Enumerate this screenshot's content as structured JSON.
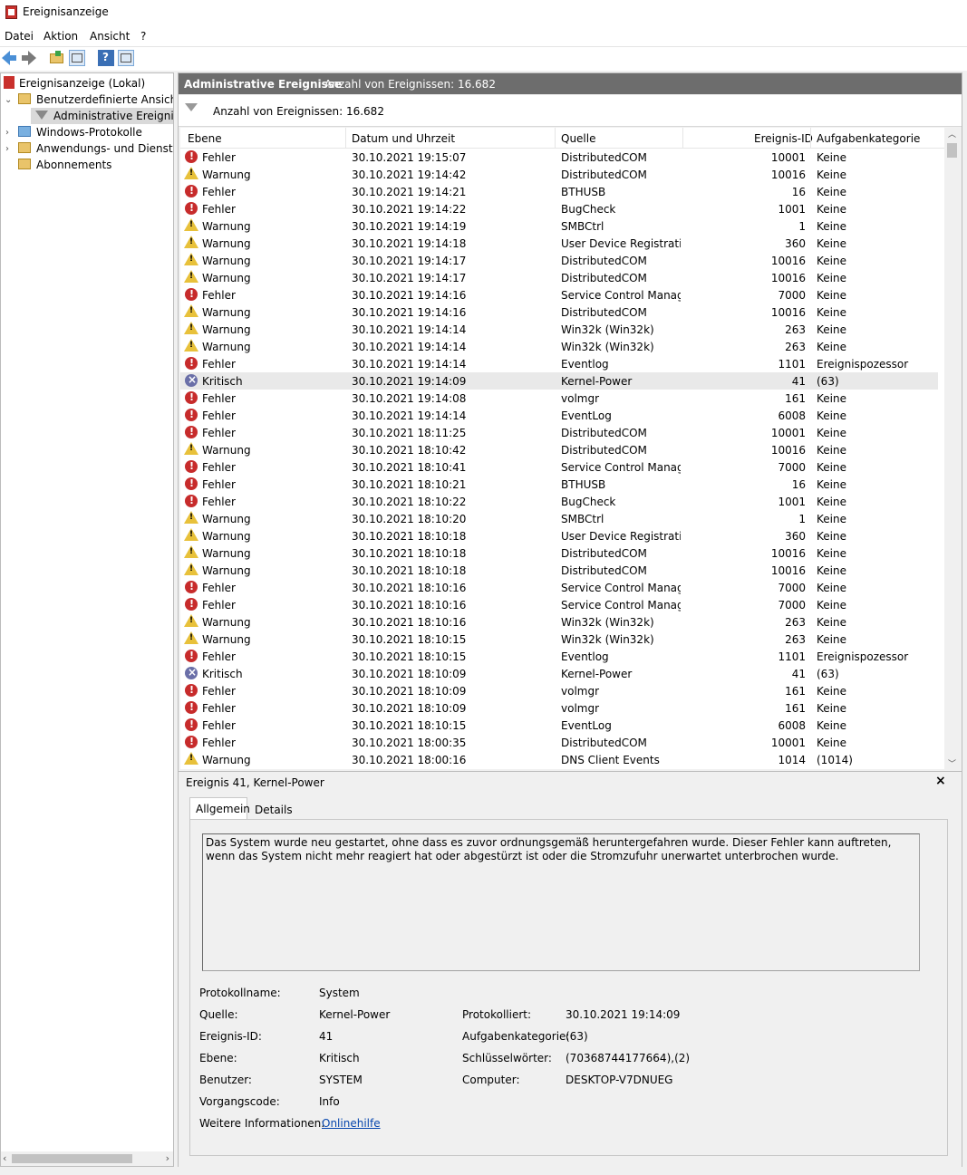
{
  "window": {
    "title": "Ereignisanzeige"
  },
  "menu": [
    "Datei",
    "Aktion",
    "Ansicht",
    "?"
  ],
  "toolbar": {
    "icons": [
      "back-arrow-icon",
      "forward-arrow-icon",
      "open-folder-icon",
      "show-hide-tree-icon",
      "help-icon",
      "show-hide-action-pane-icon"
    ]
  },
  "tree": {
    "root": "Ereignisanzeige (Lokal)",
    "custom_views": "Benutzerdefinierte Ansichten",
    "admin_events": "Administrative Ereignisse",
    "windows_logs": "Windows-Protokolle",
    "app_logs": "Anwendungs- und Dienstpro",
    "subscriptions": "Abonnements"
  },
  "main": {
    "header_title": "Administrative Ereignisse",
    "header_count": "Anzahl von Ereignissen: 16.682",
    "filter_text": "Anzahl von Ereignissen: 16.682",
    "columns": [
      "Ebene",
      "Datum und Uhrzeit",
      "Quelle",
      "Ereignis-ID",
      "Aufgabenkategorie"
    ],
    "selected_index": 13,
    "rows": [
      {
        "level": "Fehler",
        "icon": "error-icon",
        "date": "30.10.2021 19:15:07",
        "source": "DistributedCOM",
        "id": "10001",
        "cat": "Keine"
      },
      {
        "level": "Warnung",
        "icon": "warning-icon",
        "date": "30.10.2021 19:14:42",
        "source": "DistributedCOM",
        "id": "10016",
        "cat": "Keine"
      },
      {
        "level": "Fehler",
        "icon": "error-icon",
        "date": "30.10.2021 19:14:21",
        "source": "BTHUSB",
        "id": "16",
        "cat": "Keine"
      },
      {
        "level": "Fehler",
        "icon": "error-icon",
        "date": "30.10.2021 19:14:22",
        "source": "BugCheck",
        "id": "1001",
        "cat": "Keine"
      },
      {
        "level": "Warnung",
        "icon": "warning-icon",
        "date": "30.10.2021 19:14:19",
        "source": "SMBCtrl",
        "id": "1",
        "cat": "Keine"
      },
      {
        "level": "Warnung",
        "icon": "warning-icon",
        "date": "30.10.2021 19:14:18",
        "source": "User Device Registration",
        "id": "360",
        "cat": "Keine"
      },
      {
        "level": "Warnung",
        "icon": "warning-icon",
        "date": "30.10.2021 19:14:17",
        "source": "DistributedCOM",
        "id": "10016",
        "cat": "Keine"
      },
      {
        "level": "Warnung",
        "icon": "warning-icon",
        "date": "30.10.2021 19:14:17",
        "source": "DistributedCOM",
        "id": "10016",
        "cat": "Keine"
      },
      {
        "level": "Fehler",
        "icon": "error-icon",
        "date": "30.10.2021 19:14:16",
        "source": "Service Control Manag...",
        "id": "7000",
        "cat": "Keine"
      },
      {
        "level": "Warnung",
        "icon": "warning-icon",
        "date": "30.10.2021 19:14:16",
        "source": "DistributedCOM",
        "id": "10016",
        "cat": "Keine"
      },
      {
        "level": "Warnung",
        "icon": "warning-icon",
        "date": "30.10.2021 19:14:14",
        "source": "Win32k (Win32k)",
        "id": "263",
        "cat": "Keine"
      },
      {
        "level": "Warnung",
        "icon": "warning-icon",
        "date": "30.10.2021 19:14:14",
        "source": "Win32k (Win32k)",
        "id": "263",
        "cat": "Keine"
      },
      {
        "level": "Fehler",
        "icon": "error-icon",
        "date": "30.10.2021 19:14:14",
        "source": "Eventlog",
        "id": "1101",
        "cat": "Ereignispozessor"
      },
      {
        "level": "Kritisch",
        "icon": "critical-icon",
        "date": "30.10.2021 19:14:09",
        "source": "Kernel-Power",
        "id": "41",
        "cat": "(63)"
      },
      {
        "level": "Fehler",
        "icon": "error-icon",
        "date": "30.10.2021 19:14:08",
        "source": "volmgr",
        "id": "161",
        "cat": "Keine"
      },
      {
        "level": "Fehler",
        "icon": "error-icon",
        "date": "30.10.2021 19:14:14",
        "source": "EventLog",
        "id": "6008",
        "cat": "Keine"
      },
      {
        "level": "Fehler",
        "icon": "error-icon",
        "date": "30.10.2021 18:11:25",
        "source": "DistributedCOM",
        "id": "10001",
        "cat": "Keine"
      },
      {
        "level": "Warnung",
        "icon": "warning-icon",
        "date": "30.10.2021 18:10:42",
        "source": "DistributedCOM",
        "id": "10016",
        "cat": "Keine"
      },
      {
        "level": "Fehler",
        "icon": "error-icon",
        "date": "30.10.2021 18:10:41",
        "source": "Service Control Manag...",
        "id": "7000",
        "cat": "Keine"
      },
      {
        "level": "Fehler",
        "icon": "error-icon",
        "date": "30.10.2021 18:10:21",
        "source": "BTHUSB",
        "id": "16",
        "cat": "Keine"
      },
      {
        "level": "Fehler",
        "icon": "error-icon",
        "date": "30.10.2021 18:10:22",
        "source": "BugCheck",
        "id": "1001",
        "cat": "Keine"
      },
      {
        "level": "Warnung",
        "icon": "warning-icon",
        "date": "30.10.2021 18:10:20",
        "source": "SMBCtrl",
        "id": "1",
        "cat": "Keine"
      },
      {
        "level": "Warnung",
        "icon": "warning-icon",
        "date": "30.10.2021 18:10:18",
        "source": "User Device Registration",
        "id": "360",
        "cat": "Keine"
      },
      {
        "level": "Warnung",
        "icon": "warning-icon",
        "date": "30.10.2021 18:10:18",
        "source": "DistributedCOM",
        "id": "10016",
        "cat": "Keine"
      },
      {
        "level": "Warnung",
        "icon": "warning-icon",
        "date": "30.10.2021 18:10:18",
        "source": "DistributedCOM",
        "id": "10016",
        "cat": "Keine"
      },
      {
        "level": "Fehler",
        "icon": "error-icon",
        "date": "30.10.2021 18:10:16",
        "source": "Service Control Manag...",
        "id": "7000",
        "cat": "Keine"
      },
      {
        "level": "Fehler",
        "icon": "error-icon",
        "date": "30.10.2021 18:10:16",
        "source": "Service Control Manag...",
        "id": "7000",
        "cat": "Keine"
      },
      {
        "level": "Warnung",
        "icon": "warning-icon",
        "date": "30.10.2021 18:10:16",
        "source": "Win32k (Win32k)",
        "id": "263",
        "cat": "Keine"
      },
      {
        "level": "Warnung",
        "icon": "warning-icon",
        "date": "30.10.2021 18:10:15",
        "source": "Win32k (Win32k)",
        "id": "263",
        "cat": "Keine"
      },
      {
        "level": "Fehler",
        "icon": "error-icon",
        "date": "30.10.2021 18:10:15",
        "source": "Eventlog",
        "id": "1101",
        "cat": "Ereignispozessor"
      },
      {
        "level": "Kritisch",
        "icon": "critical-icon",
        "date": "30.10.2021 18:10:09",
        "source": "Kernel-Power",
        "id": "41",
        "cat": "(63)"
      },
      {
        "level": "Fehler",
        "icon": "error-icon",
        "date": "30.10.2021 18:10:09",
        "source": "volmgr",
        "id": "161",
        "cat": "Keine"
      },
      {
        "level": "Fehler",
        "icon": "error-icon",
        "date": "30.10.2021 18:10:09",
        "source": "volmgr",
        "id": "161",
        "cat": "Keine"
      },
      {
        "level": "Fehler",
        "icon": "error-icon",
        "date": "30.10.2021 18:10:15",
        "source": "EventLog",
        "id": "6008",
        "cat": "Keine"
      },
      {
        "level": "Fehler",
        "icon": "error-icon",
        "date": "30.10.2021 18:00:35",
        "source": "DistributedCOM",
        "id": "10001",
        "cat": "Keine"
      },
      {
        "level": "Warnung",
        "icon": "warning-icon",
        "date": "30.10.2021 18:00:16",
        "source": "DNS Client Events",
        "id": "1014",
        "cat": "(1014)"
      }
    ]
  },
  "detail": {
    "title": "Ereignis 41, Kernel-Power",
    "close": "×",
    "tabs": [
      "Allgemein",
      "Details"
    ],
    "description": "Das System wurde neu gestartet, ohne dass es zuvor ordnungsgemäß heruntergefahren wurde. Dieser Fehler kann auftreten, wenn das System nicht mehr reagiert hat oder abgestürzt ist oder die Stromzufuhr unerwartet unterbrochen wurde.",
    "log_name_label": "Protokollname:",
    "log_name": "System",
    "source_label": "Quelle:",
    "source": "Kernel-Power",
    "logged_label": "Protokolliert:",
    "logged": "30.10.2021 19:14:09",
    "event_id_label": "Ereignis-ID:",
    "event_id": "41",
    "task_label": "Aufgabenkategorie:",
    "task": "(63)",
    "level_label": "Ebene:",
    "level": "Kritisch",
    "keywords_label": "Schlüsselwörter:",
    "keywords": "(70368744177664),(2)",
    "user_label": "Benutzer:",
    "user": "SYSTEM",
    "computer_label": "Computer:",
    "computer": "DESKTOP-V7DNUEG",
    "opcode_label": "Vorgangscode:",
    "opcode": "Info",
    "more_info_label": "Weitere Informationen:",
    "more_info_link": "Onlinehilfe"
  }
}
